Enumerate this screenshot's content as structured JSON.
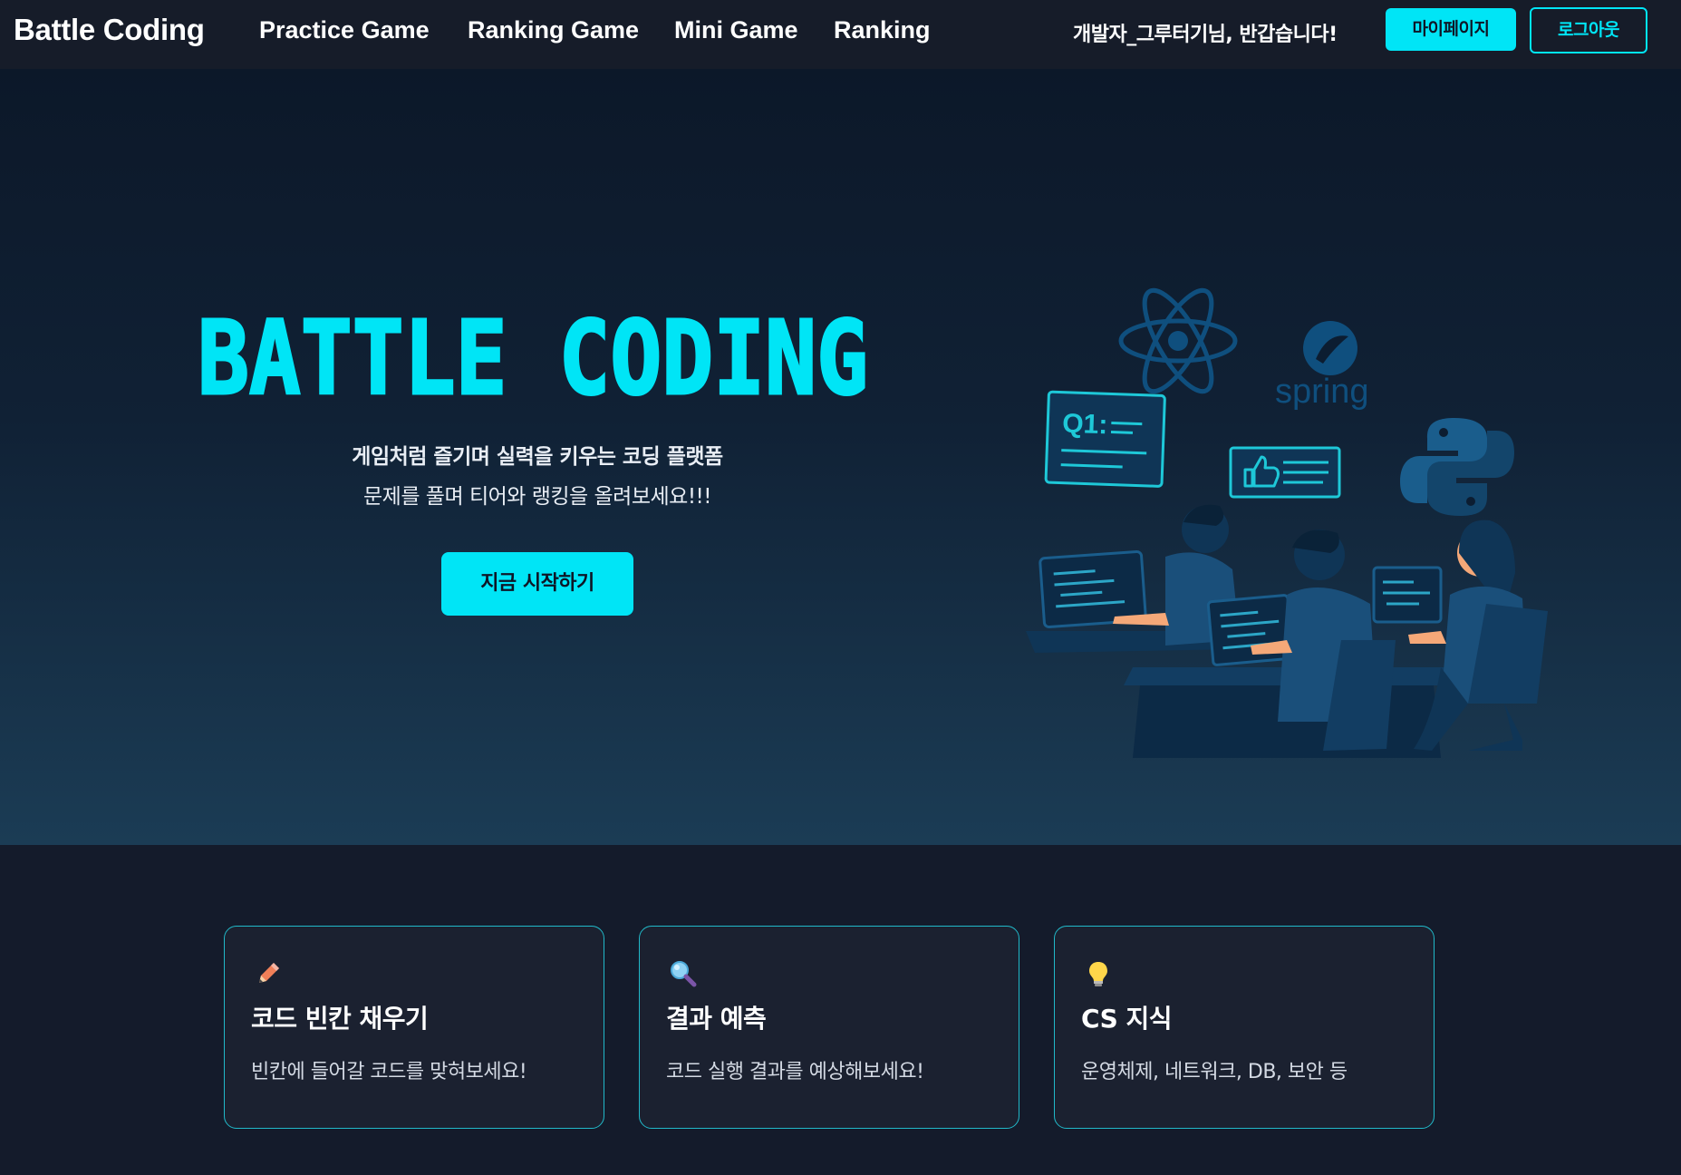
{
  "navbar": {
    "brand": "Battle Coding",
    "links": [
      {
        "label": "Practice Game"
      },
      {
        "label": "Ranking Game"
      },
      {
        "label": "Mini Game"
      },
      {
        "label": "Ranking"
      }
    ],
    "greeting": "개발자_그루터기님, 반갑습니다!",
    "mypage_label": "마이페이지",
    "logout_label": "로그아웃"
  },
  "hero": {
    "title": "BATTLE CODING",
    "subtitle_line1": "게임처럼 즐기며 실력을 키우는 코딩 플랫폼",
    "subtitle_line2": "문제를 풀며 티어와 랭킹을 올려보세요!!!",
    "cta_label": "지금 시작하기",
    "illustration": {
      "spring_label": "spring",
      "quiz_label": "Q1:"
    }
  },
  "features": [
    {
      "icon": "pencil-icon",
      "title": "코드 빈칸 채우기",
      "description": "빈칸에 들어갈 코드를 맞혀보세요!"
    },
    {
      "icon": "magnifier-icon",
      "title": "결과 예측",
      "description": "코드 실행 결과를 예상해보세요!"
    },
    {
      "icon": "lightbulb-icon",
      "title": "CS 지식",
      "description": "운영체제, 네트워크, DB, 보안 등"
    }
  ],
  "colors": {
    "accent": "#00e5f6",
    "navbar_bg": "#161c29",
    "page_bg": "#141b2b",
    "card_border": "#21b9c9"
  }
}
